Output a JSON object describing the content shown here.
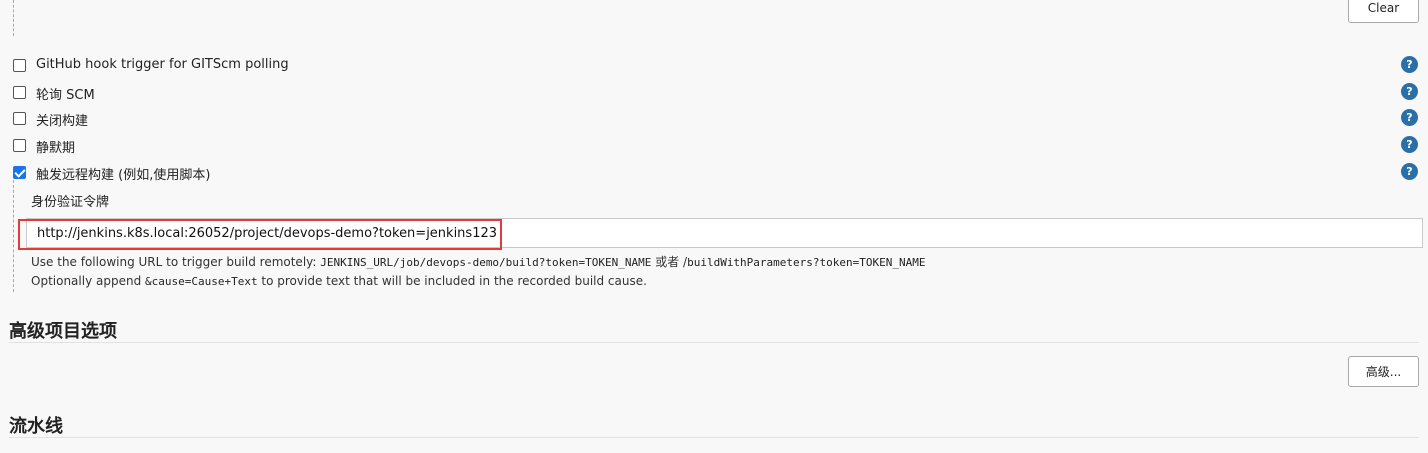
{
  "top": {
    "clear_label": "Clear"
  },
  "triggers": [
    {
      "label": "GitHub hook trigger for GITScm polling",
      "checked": false
    },
    {
      "label": "轮询 SCM",
      "checked": false
    },
    {
      "label": "关闭构建",
      "checked": false
    },
    {
      "label": "静默期",
      "checked": false
    },
    {
      "label": "触发远程构建 (例如,使用脚本)",
      "checked": true
    }
  ],
  "help_glyph": "?",
  "remote_trigger": {
    "token_label": "身份验证令牌",
    "token_value": "http://jenkins.k8s.local:26052/project/devops-demo?token=jenkins123",
    "hint1_prefix": "Use the following URL to trigger build remotely: ",
    "hint1_code1": "JENKINS_URL/job/devops-demo/build?token=TOKEN_NAME",
    "hint1_mid": " 或者 /",
    "hint1_code2": "buildWithParameters?token=TOKEN_NAME",
    "hint2_prefix": "Optionally append ",
    "hint2_code": "&cause=Cause+Text",
    "hint2_suffix": " to provide text that will be included in the recorded build cause."
  },
  "advanced": {
    "title": "高级项目选项",
    "button_label": "高级..."
  },
  "pipeline": {
    "title": "流水线"
  },
  "colors": {
    "highlight": "#e23b3b",
    "help_icon": "#2a6fa8",
    "checkbox_checked": "#1a73e8"
  }
}
